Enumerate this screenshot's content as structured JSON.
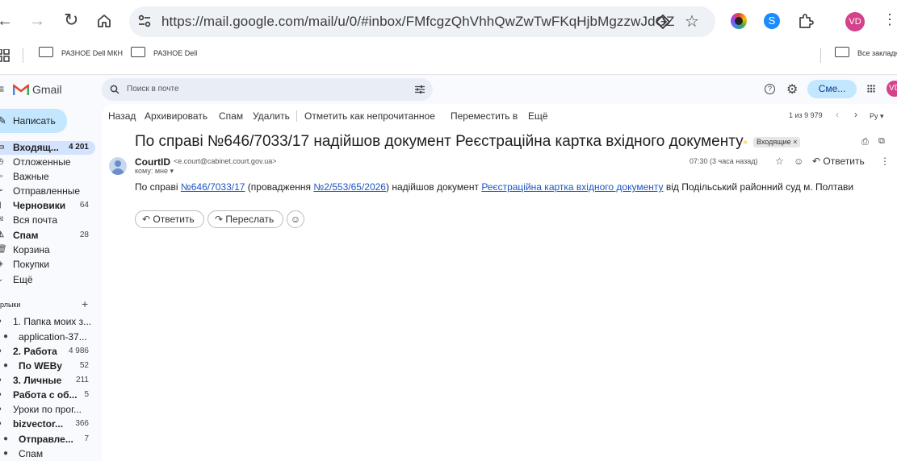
{
  "browser": {
    "url": "https://mail.google.com/mail/u/0/#inbox/FMfcgzQhVhhQwZwTwFKqHjbMgzzwJdGZ",
    "profile_initials": "VD",
    "bookmarks": [
      "РАЗНОЕ Dell МКН",
      "РАЗНОЕ Dell"
    ],
    "all_bookmarks": "Все закладки"
  },
  "gmail": {
    "app_name": "Gmail",
    "search_placeholder": "Поиск в почте",
    "upgrade_label": "Сме...",
    "avatar_initials": "VD",
    "compose_label": "Написать",
    "nav": [
      {
        "label": "Входящ...",
        "count": "4 201",
        "bold": true
      },
      {
        "label": "Отложенные",
        "count": ""
      },
      {
        "label": "Важные",
        "count": ""
      },
      {
        "label": "Отправленные",
        "count": ""
      },
      {
        "label": "Черновики",
        "count": "64",
        "bold": true
      },
      {
        "label": "Вся почта",
        "count": ""
      },
      {
        "label": "Спам",
        "count": "28",
        "bold": true
      },
      {
        "label": "Корзина",
        "count": ""
      },
      {
        "label": "Покупки",
        "count": ""
      },
      {
        "label": "Ещё",
        "count": ""
      }
    ],
    "labels_header": "рлыки",
    "labels": [
      {
        "label": "1. Папка моих з...",
        "count": ""
      },
      {
        "label": "application-37...",
        "count": ""
      },
      {
        "label": "2. Работа",
        "count": "4 986"
      },
      {
        "label": "По WEBу",
        "count": "52"
      },
      {
        "label": "3. Личные",
        "count": "211"
      },
      {
        "label": "Работа с об...",
        "count": "5"
      },
      {
        "label": "Уроки по прог...",
        "count": ""
      },
      {
        "label": "bizvector...",
        "count": "366"
      },
      {
        "label": "Отправле...",
        "count": "7"
      },
      {
        "label": "Спам",
        "count": ""
      }
    ],
    "toolbar": {
      "back": "Назад",
      "archive": "Архивировать",
      "spam": "Спам",
      "delete": "Удалить",
      "mark_unread": "Отметить как непрочитанное",
      "move_to": "Переместить в",
      "more": "Ещё",
      "pagination": "1 из 9 979",
      "lang": "Ру"
    },
    "message": {
      "subject": "По справі №646/7033/17 надійшов документ Реєстраційна картка вхідного документу",
      "label_chip": "Входящие",
      "sender_name": "CourtID",
      "sender_email": "<e.court@cabinet.court.gov.ua>",
      "to_line": "кому: мне",
      "time": "07:30 (3 часа назад)",
      "reply_label": "Ответить",
      "body": {
        "t1": "По справі ",
        "case_link": "№646/7033/17",
        "t2": " (провадження ",
        "proc_link": "№2/553/65/2026",
        "t3": ") надійшов документ ",
        "doc_link": "Реєстраційна картка вхідного документу",
        "t4": " від Подільський районний суд м. Полтави"
      },
      "reply_button": "Ответить",
      "forward_button": "Переслать"
    }
  },
  "colors": {
    "compose_bg": "#c2e7ff",
    "selected_nav_bg": "#d3e3fd",
    "link": "#1a55c4",
    "avatar": "#d3428a"
  }
}
